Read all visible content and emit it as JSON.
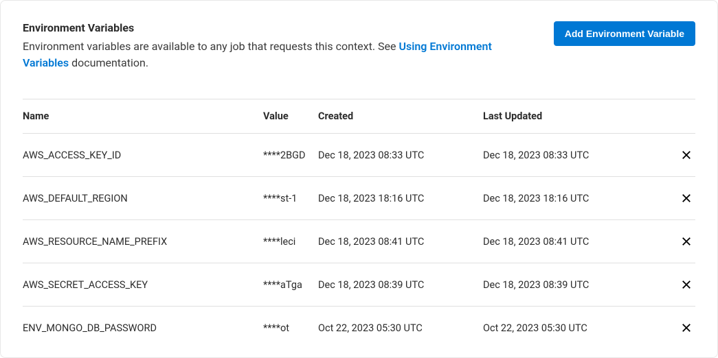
{
  "header": {
    "title": "Environment Variables",
    "desc_before": "Environment variables are available to any job that requests this context. See ",
    "desc_link": "Using Environment Variables",
    "desc_after": " documentation.",
    "add_button": "Add Environment Variable"
  },
  "table": {
    "columns": {
      "name": "Name",
      "value": "Value",
      "created": "Created",
      "updated": "Last Updated"
    },
    "rows": [
      {
        "name": "AWS_ACCESS_KEY_ID",
        "value": "****2BGD",
        "created": "Dec 18, 2023 08:33 UTC",
        "updated": "Dec 18, 2023 08:33 UTC"
      },
      {
        "name": "AWS_DEFAULT_REGION",
        "value": "****st-1",
        "created": "Dec 18, 2023 18:16 UTC",
        "updated": "Dec 18, 2023 18:16 UTC"
      },
      {
        "name": "AWS_RESOURCE_NAME_PREFIX",
        "value": "****leci",
        "created": "Dec 18, 2023 08:41 UTC",
        "updated": "Dec 18, 2023 08:41 UTC"
      },
      {
        "name": "AWS_SECRET_ACCESS_KEY",
        "value": "****aTga",
        "created": "Dec 18, 2023 08:39 UTC",
        "updated": "Dec 18, 2023 08:39 UTC"
      },
      {
        "name": "ENV_MONGO_DB_PASSWORD",
        "value": "****ot",
        "created": "Oct 22, 2023 05:30 UTC",
        "updated": "Oct 22, 2023 05:30 UTC"
      }
    ]
  }
}
